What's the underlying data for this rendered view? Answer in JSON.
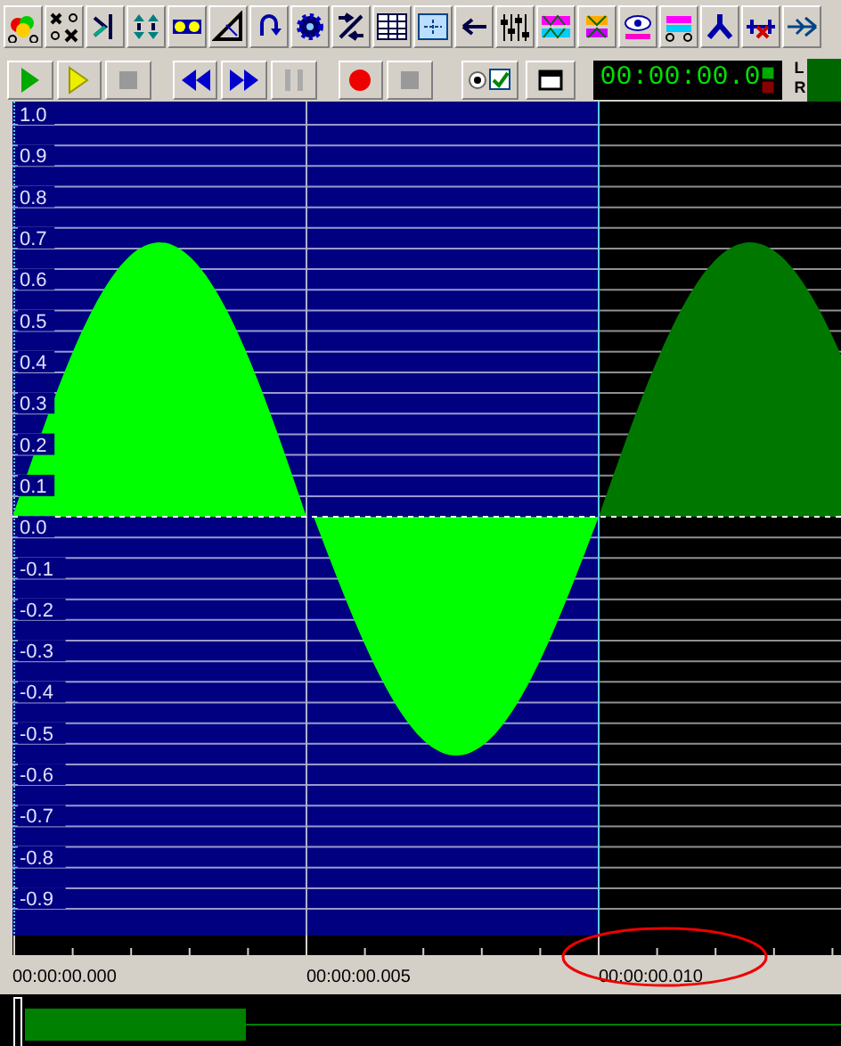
{
  "transport": [
    {
      "kind": "play",
      "disabled": false
    },
    {
      "kind": "play-selection",
      "disabled": false
    },
    {
      "kind": "stop",
      "disabled": true
    },
    {
      "kind": "rewind",
      "disabled": false
    },
    {
      "kind": "fast-forward",
      "disabled": false
    },
    {
      "kind": "pause",
      "disabled": true
    },
    {
      "kind": "record",
      "disabled": false
    },
    {
      "kind": "stop",
      "disabled": true
    }
  ],
  "time_display": "00:00:00.0",
  "meter": {
    "left": "L",
    "right": "R"
  },
  "amplitude_labels": [
    "1.0",
    "0.9",
    "0.8",
    "0.7",
    "0.6",
    "0.5",
    "0.4",
    "0.3",
    "0.2",
    "0.1",
    "0.0",
    "-0.1",
    "-0.2",
    "-0.3",
    "-0.4",
    "-0.5",
    "-0.6",
    "-0.7",
    "-0.8",
    "-0.9"
  ],
  "time_labels": [
    {
      "text": "00:00:00.000",
      "highlighted": false
    },
    {
      "text": "00:00:00.005",
      "highlighted": false
    },
    {
      "text": "00:00:00.010",
      "highlighted": true
    }
  ]
}
